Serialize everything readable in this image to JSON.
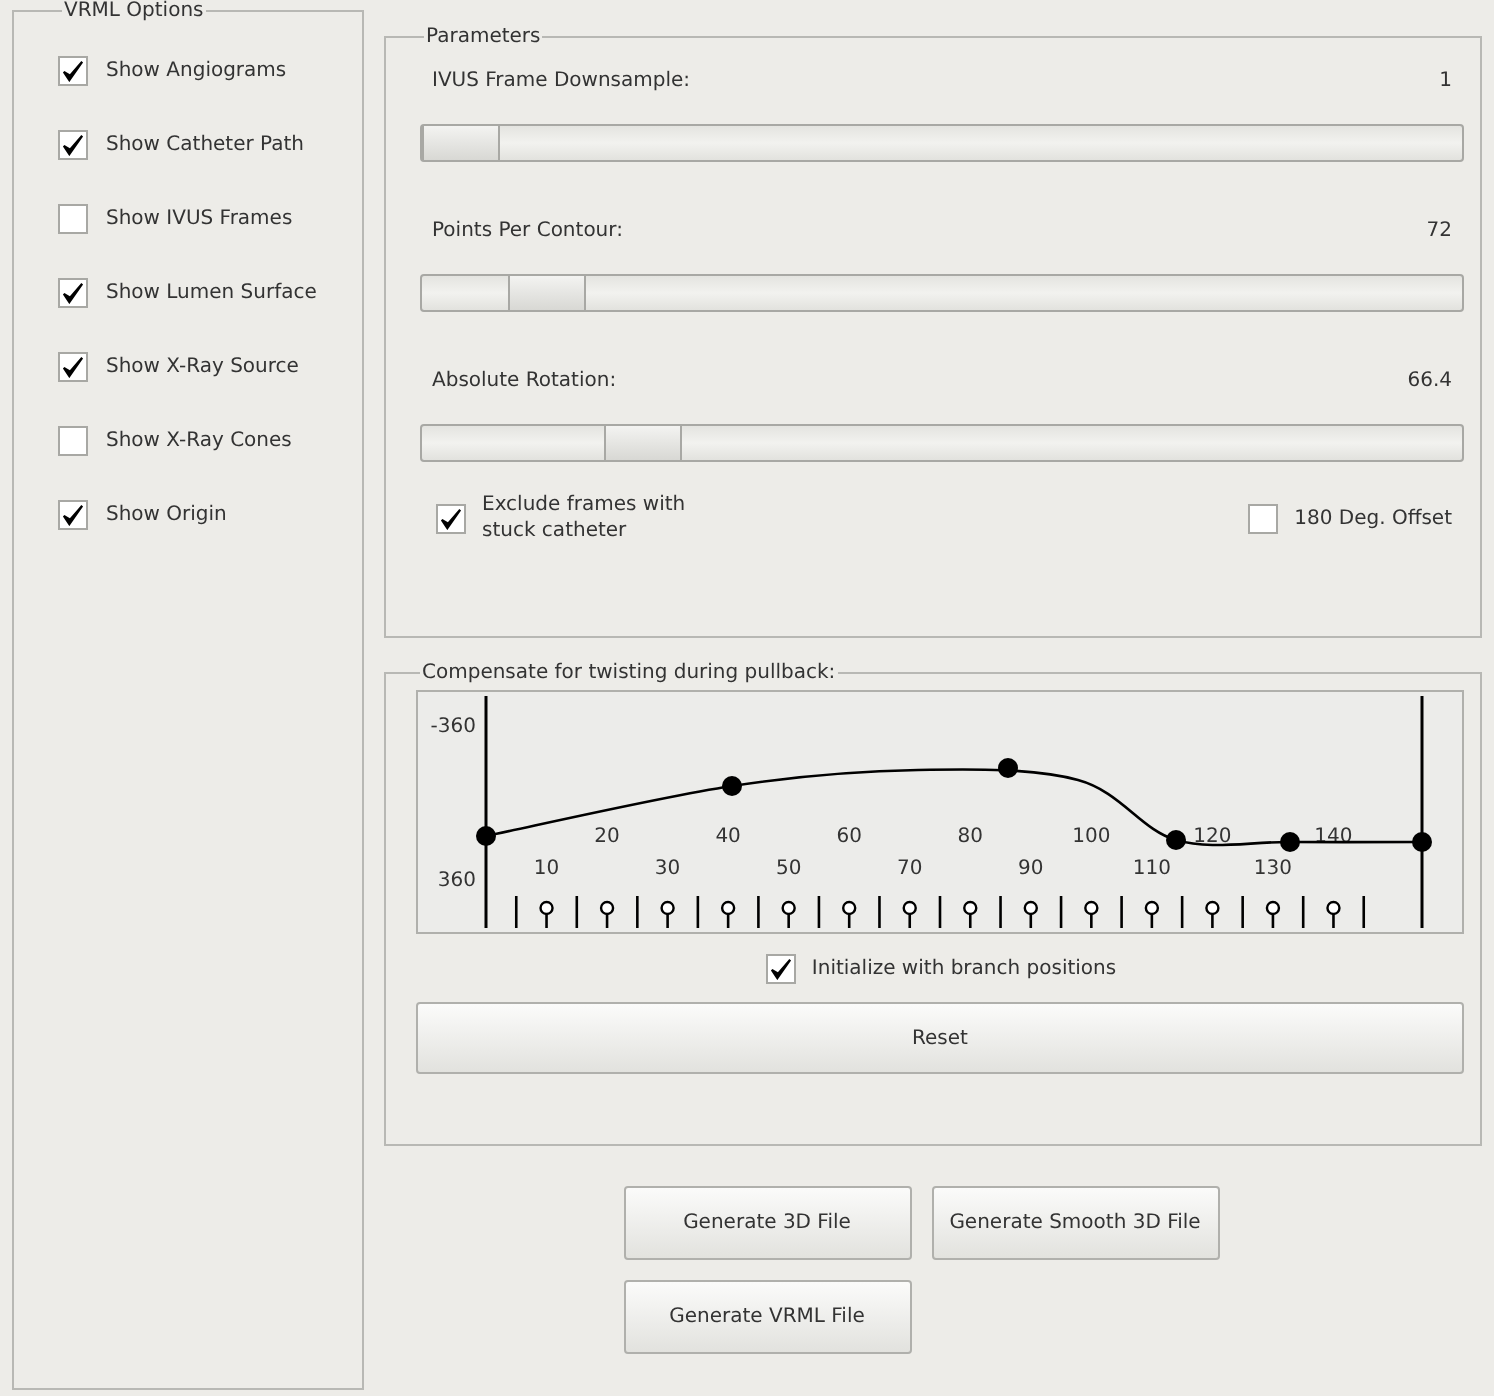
{
  "vrml_options": {
    "title": "VRML Options",
    "items": [
      {
        "label": "Show Angiograms",
        "checked": true
      },
      {
        "label": "Show Catheter Path",
        "checked": true
      },
      {
        "label": "Show IVUS Frames",
        "checked": false
      },
      {
        "label": "Show Lumen Surface",
        "checked": true
      },
      {
        "label": "Show X-Ray Source",
        "checked": true
      },
      {
        "label": "Show X-Ray Cones",
        "checked": false
      },
      {
        "label": "Show Origin",
        "checked": true
      }
    ]
  },
  "parameters": {
    "title": "Parameters",
    "sliders": [
      {
        "label": "IVUS Frame Downsample:",
        "reading": "1",
        "level": 0
      },
      {
        "label": "Points Per Contour:",
        "reading": "72",
        "level": 0.09
      },
      {
        "label": "Absolute Rotation:",
        "reading": "66.4",
        "level": 0.19
      }
    ],
    "exclude_frames": {
      "label": "Exclude frames with stuck catheter",
      "checked": true
    },
    "offset_180": {
      "label": "180 Deg. Offset",
      "checked": false
    }
  },
  "twist": {
    "title": "Compensate for twisting during pullback:",
    "y_labels": [
      "-360",
      "360"
    ],
    "x_labels": [
      "10",
      "20",
      "30",
      "40",
      "50",
      "60",
      "70",
      "80",
      "90",
      "100",
      "110",
      "120",
      "130",
      "140"
    ],
    "initialize": {
      "label": "Initialize with branch positions",
      "checked": true
    },
    "reset_button": "Reset"
  },
  "buttons": [
    "Generate 3D File",
    "Generate Smooth 3D File",
    "Generate VRML File"
  ]
}
